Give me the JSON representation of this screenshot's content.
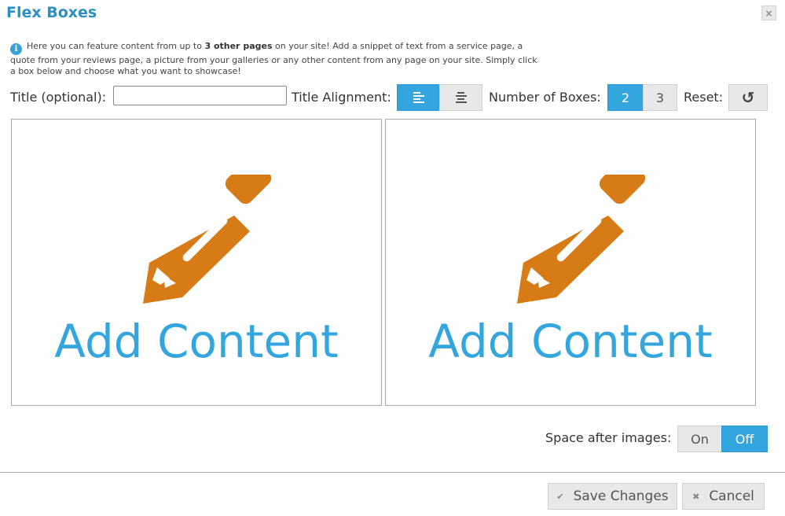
{
  "dialog": {
    "title": "Flex Boxes",
    "close_icon": "×"
  },
  "info": {
    "icon": "i",
    "text_before": "Here you can feature content from up to ",
    "text_bold": "3 other pages",
    "text_after": " on your site! Add a snippet of text from a service page, a quote from your reviews page, a picture from your galleries or any other content from any page on your site. Simply click a box below and choose what you want to showcase!"
  },
  "controls": {
    "title_label": "Title (optional):",
    "title_value": "",
    "title_placeholder": "",
    "alignment_label": "Title Alignment:",
    "alignment_options": [
      {
        "name": "left",
        "active": true
      },
      {
        "name": "center",
        "active": false
      }
    ],
    "boxes_label": "Number of Boxes:",
    "boxes_options": [
      {
        "label": "2",
        "active": true
      },
      {
        "label": "3",
        "active": false
      }
    ],
    "reset_label": "Reset:",
    "reset_icon": "↺"
  },
  "boxes": [
    {
      "label": "Add Content",
      "icon": "pencil-icon"
    },
    {
      "label": "Add Content",
      "icon": "pencil-icon"
    }
  ],
  "space_after_images": {
    "label": "Space after images:",
    "options": [
      {
        "label": "On",
        "active": false
      },
      {
        "label": "Off",
        "active": true
      }
    ]
  },
  "footer": {
    "save_icon": "✔",
    "save_label": "Save Changes",
    "cancel_icon": "✖",
    "cancel_label": "Cancel"
  },
  "colors": {
    "accent": "#33a6df",
    "title": "#2a8fc7",
    "pencil": "#d67b16"
  }
}
